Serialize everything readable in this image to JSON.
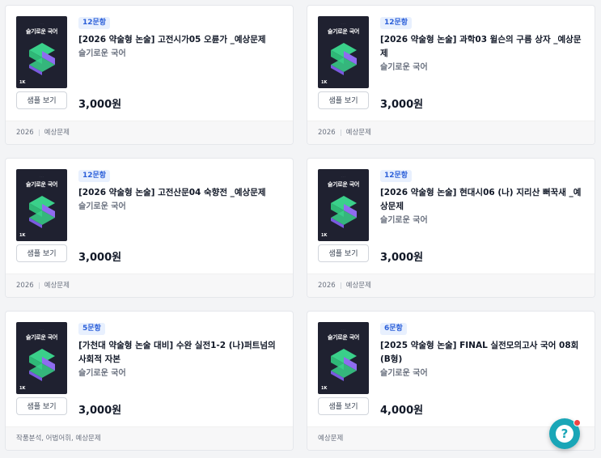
{
  "thumb": {
    "sub_text": "· · ·",
    "title": "슬기로운 국어",
    "mark": "1K",
    "logo_color": "#3ad08a"
  },
  "sample_label": "샘플 보기",
  "cards": [
    {
      "badge": "12문항",
      "name": "[2026 약술형 논술] 고전시가05 오륜가 _예상문제",
      "author": "슬기로운 국어",
      "price": "3,000원",
      "tags": [
        "2026",
        "예상문제"
      ]
    },
    {
      "badge": "12문항",
      "name": "[2026 약술형 논술] 과학03 윌슨의 구름 상자 _예상문제",
      "author": "슬기로운 국어",
      "price": "3,000원",
      "tags": [
        "2026",
        "예상문제"
      ]
    },
    {
      "badge": "12문항",
      "name": "[2026 약술형 논술] 고전산문04 숙향전 _예상문제",
      "author": "슬기로운 국어",
      "price": "3,000원",
      "tags": [
        "2026",
        "예상문제"
      ]
    },
    {
      "badge": "12문항",
      "name": "[2026 약술형 논술] 현대시06 (나) 지리산 뻐꾹새 _예상문제",
      "author": "슬기로운 국어",
      "price": "3,000원",
      "tags": [
        "2026",
        "예상문제"
      ]
    },
    {
      "badge": "5문항",
      "name": "[가천대 약술형 논술 대비] 수완 실전1-2 (나)퍼트넘의 사회적 자본",
      "author": "슬기로운 국어",
      "price": "3,000원",
      "tags": [
        "작품분석, 어법어휘, 예상문제"
      ]
    },
    {
      "badge": "6문항",
      "name": "[2025 약술형 논술] FINAL 실전모의고사 국어 08회 (B형)",
      "author": "슬기로운 국어",
      "price": "4,000원",
      "tags": [
        "예상문제"
      ]
    }
  ],
  "fab": {
    "icon": "?",
    "icon_name": "help-icon"
  }
}
